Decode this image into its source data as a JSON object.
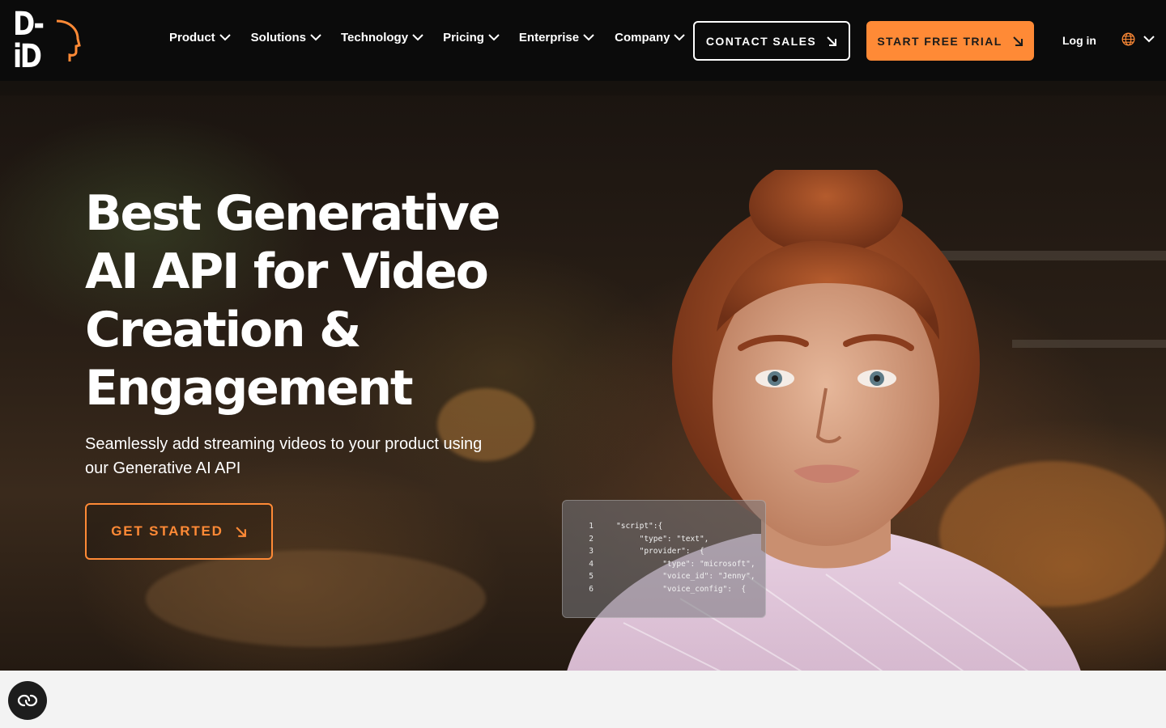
{
  "brand": {
    "logo_text": "D-iD"
  },
  "nav": {
    "items": [
      {
        "label": "Product"
      },
      {
        "label": "Solutions"
      },
      {
        "label": "Technology"
      },
      {
        "label": "Pricing"
      },
      {
        "label": "Enterprise"
      },
      {
        "label": "Company"
      }
    ],
    "contact_sales": "CONTACT SALES",
    "start_trial": "START FREE TRIAL",
    "login": "Log in"
  },
  "hero": {
    "headline": "Best Generative AI API for Video Creation & Engagement",
    "subtitle": "Seamlessly add streaming videos to your product using our Generative AI API",
    "cta": "GET STARTED"
  },
  "code_card": {
    "lines": [
      {
        "num": "1",
        "text": "\"script\":{"
      },
      {
        "num": "2",
        "text": "     \"type\": \"text\","
      },
      {
        "num": "3",
        "text": "     \"provider\":  {"
      },
      {
        "num": "4",
        "text": "          \"type\": \"microsoft\","
      },
      {
        "num": "5",
        "text": "          \"voice_id\": \"Jenny\","
      },
      {
        "num": "6",
        "text": "          \"voice_config\":  {"
      }
    ]
  },
  "colors": {
    "accent": "#ff8a36",
    "nav_bg": "#0b0b0b",
    "page_bg": "#f3f3f3"
  },
  "icons": {
    "dropdown": "chevron-down-icon",
    "arrow": "arrow-down-right-icon",
    "globe": "globe-icon",
    "accessibility": "accessibility-icon"
  }
}
